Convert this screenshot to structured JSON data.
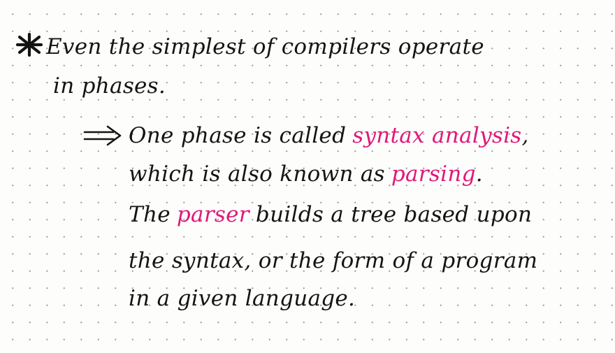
{
  "note": {
    "bullet_icon": "asterisk-icon",
    "sub_bullet_icon": "double-arrow-icon",
    "accent_color": "#e0187a",
    "ink_color": "#141414",
    "line1": "Even the simplest of compilers operate",
    "line2": "in phases.",
    "line3_a": "One phase is called",
    "line3_term": "syntax analysis",
    "line3_b": ",",
    "line4_a": "which is also known as",
    "line4_term": "parsing",
    "line4_b": ".",
    "line5_a": "The",
    "line5_term": "parser",
    "line5_b": "builds a tree based upon",
    "line6": "the syntax, or the form of a program",
    "line7": "in a given language."
  }
}
